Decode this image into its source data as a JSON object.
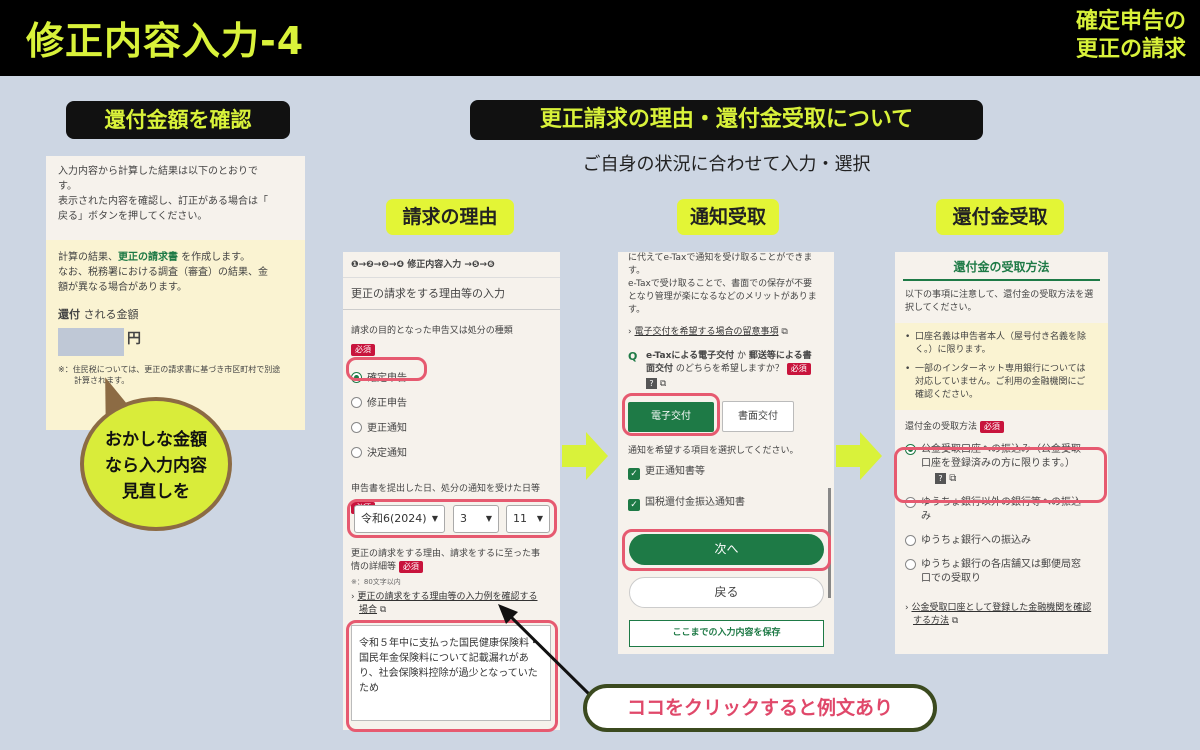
{
  "header": {
    "title": "修正内容入力-4",
    "corner_line1": "確定申告の",
    "corner_line2": "更正の請求"
  },
  "left": {
    "label": "還付金額を確認",
    "intro": [
      "入力内容から計算した結果は以下のとおりで",
      "す。",
      "表示された内容を確認し、訂正がある場合は「",
      "戻る」ボタンを押してください。"
    ],
    "notice_line1_pre": "計算の結果、",
    "notice_line1_link": "更正の請求書",
    "notice_line1_post": " を作成します。",
    "notice_line2": "なお、税務署における調査（審査）の結果、金",
    "notice_line3": "額が異なる場合があります。",
    "refund_label_bold": "還付",
    "refund_label_rest": " される金額",
    "yen": "円",
    "footnote_1": "※：住民税については、更正の請求書に基づき市区町村で別途",
    "footnote_2": "計算されます。",
    "bubble": [
      "おかしな金額",
      "なら入力内容",
      "見直しを"
    ]
  },
  "center": {
    "label": "更正請求の理由・還付金受取について",
    "subtitle": "ご自身の状況に合わせて入力・選択"
  },
  "reason": {
    "label": "請求の理由",
    "steps": "❶→❷→❸→❹ 修正内容入力 →❺→❻",
    "heading": "更正の請求をする理由等の入力",
    "q1": "請求の目的となった申告又は処分の種類",
    "required": "必須",
    "options": [
      "確定申告",
      "修正申告",
      "更正通知",
      "決定通知"
    ],
    "q2": "申告書を提出した日、処分の通知を受けた日等",
    "era": "令和6(2024)",
    "month": "3",
    "day": "11",
    "q3_line1": "更正の請求をする理由、請求をするに至った事",
    "q3_line2": "情の詳細等",
    "char_note": "※：80文字以内",
    "example_link_line1": "更正の請求をする理由等の入力例を確認する",
    "example_link_line2": "場合",
    "textarea_value": "令和５年中に支払った国民健康保険料・国民年金保険料について記載漏れがあり、社会保険料控除が過少となっていたため"
  },
  "notify": {
    "label": "通知受取",
    "text_top": "に代えてe-Taxで通知を受け取ることができま",
    "text_2": "す。",
    "text_3": "e-Taxで受け取ることで、書面での保存が不要",
    "text_4": "となり管理が楽になるなどのメリットがありま",
    "text_5": "す。",
    "link": "電子交付を希望する場合の留意事項",
    "q_mark": "Q",
    "q_line1_a": "e-Taxによる電子交付",
    "q_line1_b": " か ",
    "q_line1_c": "郵送等による書",
    "q_line2_a": "面交付",
    "q_line2_b": " のどちらを希望しますか？",
    "required": "必須",
    "btn_electronic": "電子交付",
    "btn_paper": "書面交付",
    "select_text": "通知を希望する項目を選択してください。",
    "check1": "更正通知書等",
    "check2": "国税還付金振込通知書",
    "next": "次へ",
    "back": "戻る",
    "save": "ここまでの入力内容を保存"
  },
  "refund": {
    "label": "還付金受取",
    "title": "還付金の受取方法",
    "intro_1": "以下の事項に注意して、還付金の受取方法を選",
    "intro_2": "択してください。",
    "note1_1": "口座名義は申告者本人（屋号付き名義を除",
    "note1_2": "く。）に限ります。",
    "note2_1": "一部のインターネット専用銀行については",
    "note2_2": "対応していません。ご利用の金融機関にご",
    "note2_3": "確認ください。",
    "method_label": "還付金の受取方法",
    "required": "必須",
    "opt1_1": "公金受取口座への振込み（公金受取",
    "opt1_2": "口座を登録済みの方に限ります。）",
    "opt2_1": "ゆうちょ銀行以外の銀行等への振込",
    "opt2_2": "み",
    "opt3": "ゆうちょ銀行への振込み",
    "opt4_1": "ゆうちょ銀行の各店舗又は郵便局窓",
    "opt4_2": "口での受取り",
    "link_1": "公金受取口座として登録した金融機関を確認",
    "link_2": "する方法"
  },
  "callout": "ココをクリックすると例文あり"
}
